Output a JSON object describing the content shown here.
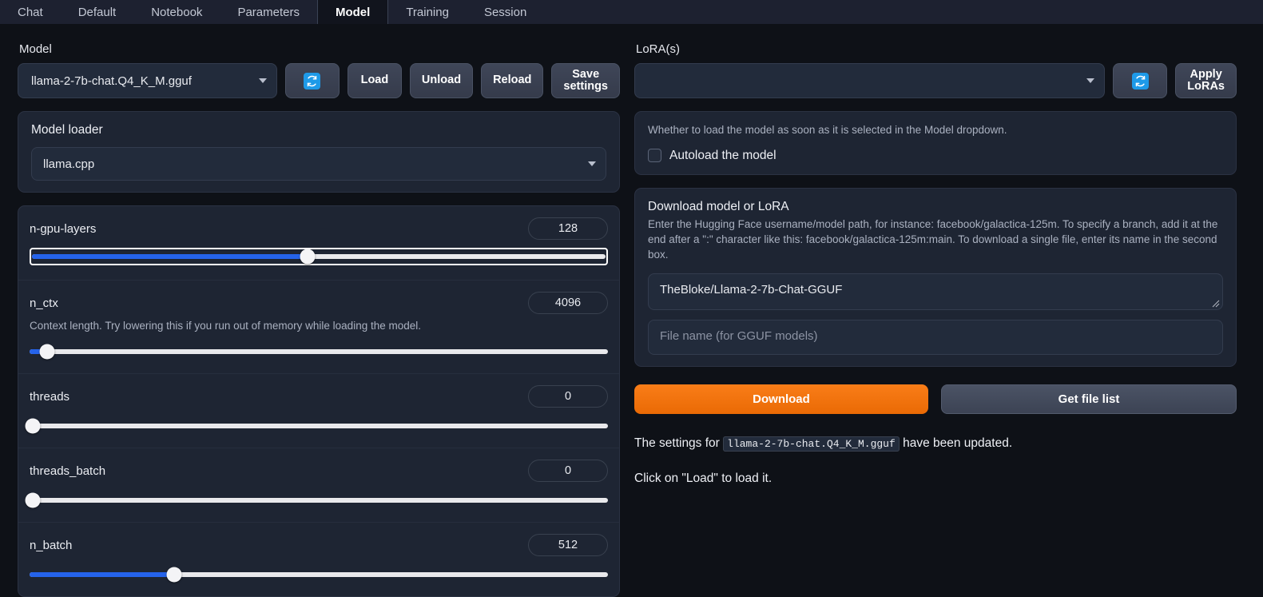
{
  "tabs": [
    {
      "label": "Chat",
      "active": false
    },
    {
      "label": "Default",
      "active": false
    },
    {
      "label": "Notebook",
      "active": false
    },
    {
      "label": "Parameters",
      "active": false
    },
    {
      "label": "Model",
      "active": true
    },
    {
      "label": "Training",
      "active": false
    },
    {
      "label": "Session",
      "active": false
    }
  ],
  "left": {
    "model_label": "Model",
    "model_value": "llama-2-7b-chat.Q4_K_M.gguf",
    "refresh_icon": "refresh-icon",
    "buttons": {
      "load": "Load",
      "unload": "Unload",
      "reload": "Reload",
      "save_settings": "Save\nsettings"
    },
    "loader": {
      "title": "Model loader",
      "value": "llama.cpp"
    },
    "sliders": [
      {
        "name": "n-gpu-layers",
        "value": "128",
        "desc": "",
        "percent": 48,
        "focused": true
      },
      {
        "name": "n_ctx",
        "value": "4096",
        "desc": "Context length. Try lowering this if you run out of memory while loading the model.",
        "percent": 3,
        "focused": false
      },
      {
        "name": "threads",
        "value": "0",
        "desc": "",
        "percent": 0,
        "focused": false
      },
      {
        "name": "threads_batch",
        "value": "0",
        "desc": "",
        "percent": 0,
        "focused": false
      },
      {
        "name": "n_batch",
        "value": "512",
        "desc": "",
        "percent": 25,
        "focused": false
      }
    ]
  },
  "right": {
    "lora_label": "LoRA(s)",
    "lora_value": "",
    "refresh_icon": "refresh-icon",
    "apply_loras": "Apply\nLoRAs",
    "autoload": {
      "help": "Whether to load the model as soon as it is selected in the Model dropdown.",
      "label": "Autoload the model",
      "checked": false
    },
    "download": {
      "title": "Download model or LoRA",
      "help": "Enter the Hugging Face username/model path, for instance: facebook/galactica-125m. To specify a branch, add it at the end after a \":\" character like this: facebook/galactica-125m:main. To download a single file, enter its name in the second box.",
      "repo_value": "TheBloke/Llama-2-7b-Chat-GGUF",
      "repo_placeholder": "",
      "file_value": "",
      "file_placeholder": "File name (for GGUF models)",
      "download_button": "Download",
      "get_file_list_button": "Get file list"
    },
    "status": {
      "line1_prefix": "The settings for ",
      "line1_code": "llama-2-7b-chat.Q4_K_M.gguf",
      "line1_suffix": " have been updated.",
      "line2": "Click on \"Load\" to load it."
    }
  },
  "colors": {
    "accent_blue": "#2563eb",
    "icon_blue": "#1e9ae8",
    "download_orange": "#ea6a05",
    "page_bg": "#0e1117",
    "panel_bg": "#1e2533",
    "tabbar_bg": "#1d2130"
  }
}
